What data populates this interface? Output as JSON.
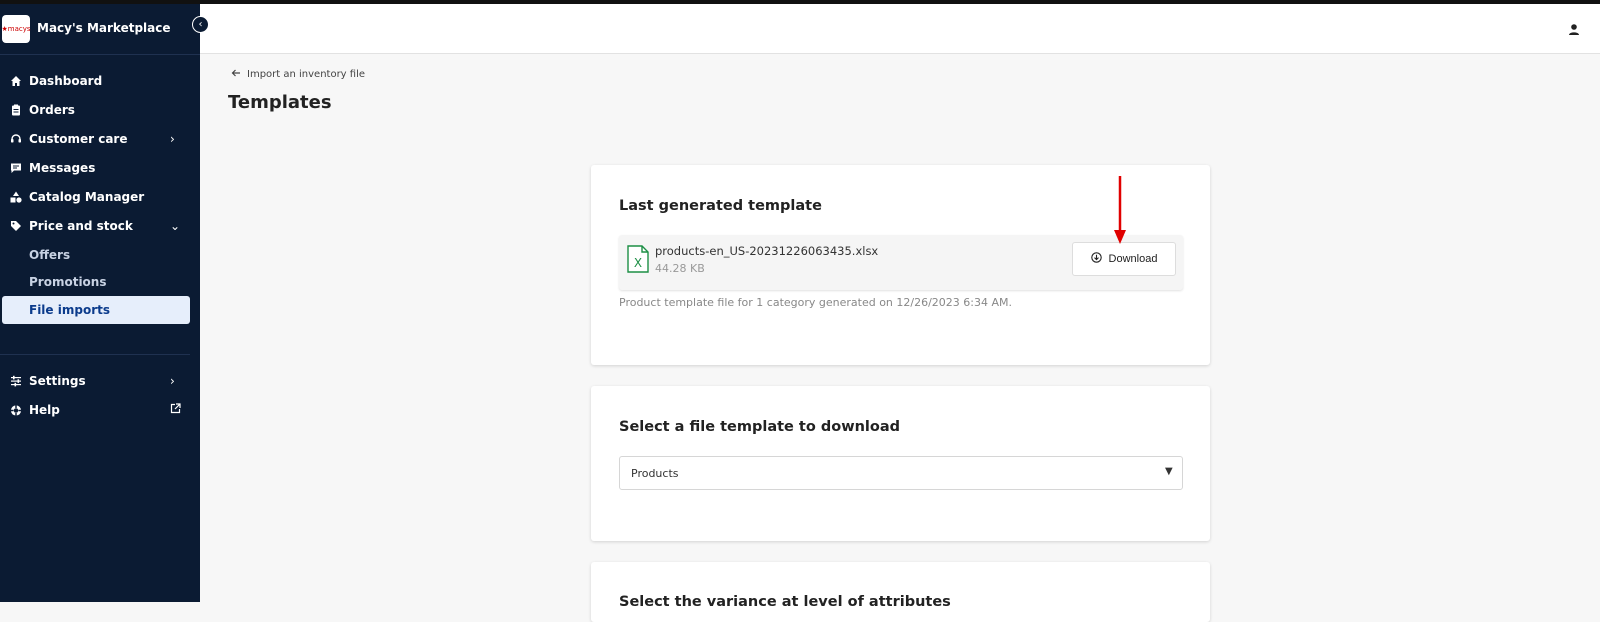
{
  "sidebar": {
    "brand": {
      "logo_text": "★macys",
      "name": "Macy's Marketplace"
    },
    "items": [
      {
        "label": "Dashboard",
        "icon": "home-icon"
      },
      {
        "label": "Orders",
        "icon": "clipboard-icon"
      },
      {
        "label": "Customer care",
        "icon": "headset-icon"
      },
      {
        "label": "Messages",
        "icon": "message-icon"
      },
      {
        "label": "Catalog Manager",
        "icon": "shapes-icon"
      },
      {
        "label": "Price and stock",
        "icon": "tag-icon"
      }
    ],
    "subitems": [
      {
        "label": "Offers"
      },
      {
        "label": "Promotions"
      },
      {
        "label": "File imports"
      }
    ],
    "bottom_items": [
      {
        "label": "Settings",
        "icon": "sliders-icon"
      },
      {
        "label": "Help",
        "icon": "lifebuoy-icon"
      }
    ]
  },
  "header": {
    "user_icon": "user-icon"
  },
  "main": {
    "back_link": "Import an inventory file",
    "title": "Templates"
  },
  "last_generated": {
    "title": "Last generated template",
    "file_name": "products-en_US-20231226063435.xlsx",
    "file_size": "44.28 KB",
    "download_label": "Download",
    "description": "Product template file for 1 category generated on 12/26/2023 6:34 AM."
  },
  "select_template": {
    "title": "Select a file template to download",
    "selected": "Products"
  },
  "third_card": {
    "title": "Select the variance at level of attributes"
  },
  "colors": {
    "sidebar_bg": "#0b1b33",
    "active_bg": "#e6eefb",
    "annotation_arrow": "#e00000",
    "excel_green": "#1d8f45"
  }
}
